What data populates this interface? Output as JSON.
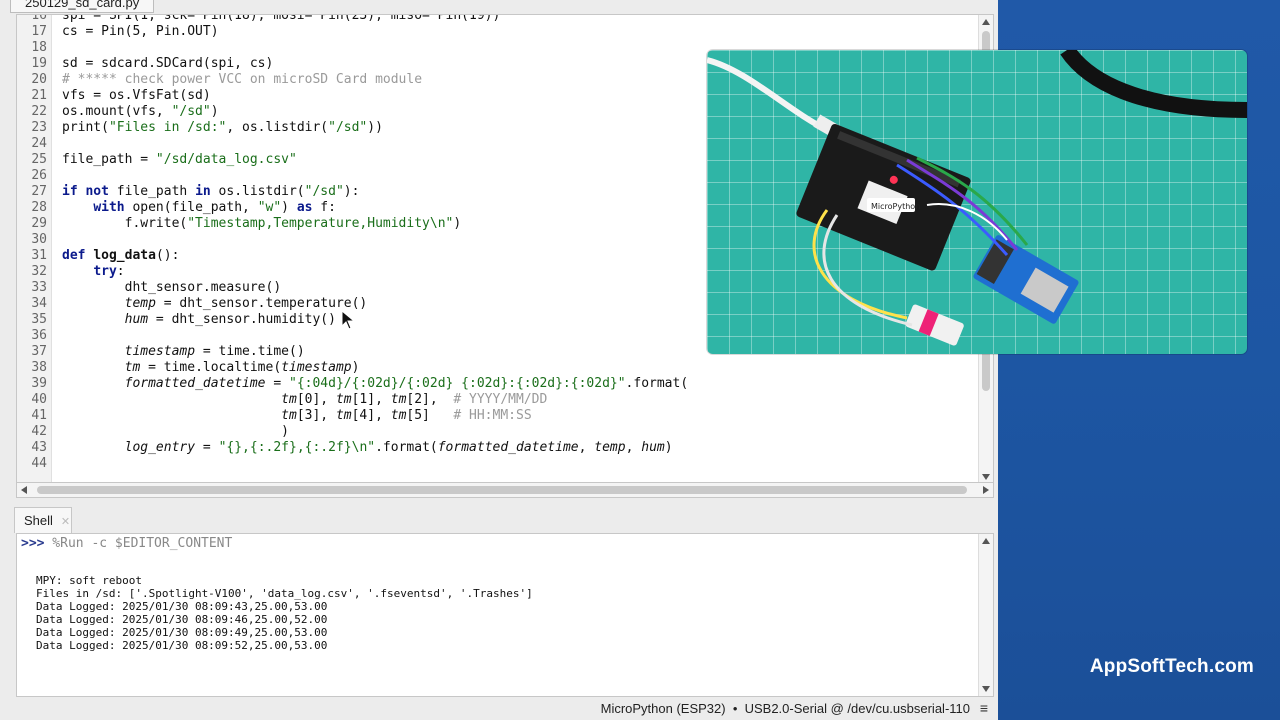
{
  "editor": {
    "tab_title": "250129_sd_card.py",
    "lines": [
      {
        "n": "16",
        "html": "spi = SPI(1, sck= Pin(18), mosi= Pin(23), miso= Pin(19))"
      },
      {
        "n": "17",
        "html": "cs = Pin(5, Pin.OUT)"
      },
      {
        "n": "18",
        "html": ""
      },
      {
        "n": "19",
        "html": "sd = sdcard.SDCard(spi, cs)"
      },
      {
        "n": "20",
        "html": "<span class='cm'># ***** check power VCC on microSD Card module</span>"
      },
      {
        "n": "21",
        "html": "vfs = os.VfsFat(sd)"
      },
      {
        "n": "22",
        "html": "os.mount(vfs, <span class='str'>\"/sd\"</span>)"
      },
      {
        "n": "23",
        "html": "print(<span class='str'>\"Files in /sd:\"</span>, os.listdir(<span class='str'>\"/sd\"</span>))"
      },
      {
        "n": "24",
        "html": ""
      },
      {
        "n": "25",
        "html": "file_path = <span class='str'>\"/sd/data_log.csv\"</span>"
      },
      {
        "n": "26",
        "html": ""
      },
      {
        "n": "27",
        "html": "<span class='kw'>if not</span> file_path <span class='kw'>in</span> os.listdir(<span class='str'>\"/sd\"</span>):"
      },
      {
        "n": "28",
        "html": "    <span class='kw'>with</span> open(file_path, <span class='str'>\"w\"</span>) <span class='kw'>as</span> f:"
      },
      {
        "n": "29",
        "html": "        f.write(<span class='str'>\"Timestamp,Temperature,Humidity\\n\"</span>)"
      },
      {
        "n": "30",
        "html": ""
      },
      {
        "n": "31",
        "html": "<span class='kw'>def</span> <b>log_data</b>():"
      },
      {
        "n": "32",
        "html": "    <span class='kw'>try</span>:"
      },
      {
        "n": "33",
        "html": "        dht_sensor.measure()"
      },
      {
        "n": "34",
        "html": "        <span class='it'>temp</span> = dht_sensor.temperature()"
      },
      {
        "n": "35",
        "html": "        <span class='it'>hum</span> = dht_sensor.humidity()"
      },
      {
        "n": "36",
        "html": ""
      },
      {
        "n": "37",
        "html": "        <span class='it'>timestamp</span> = time.time()"
      },
      {
        "n": "38",
        "html": "        <span class='it'>tm</span> = time.localtime(<span class='it'>timestamp</span>)"
      },
      {
        "n": "39",
        "html": "        <span class='it'>formatted_datetime</span> = <span class='str'>\"{:04d}/{:02d}/{:02d} {:02d}:{:02d}:{:02d}\"</span>.format("
      },
      {
        "n": "40",
        "html": "                            <span class='it'>tm</span>[0], <span class='it'>tm</span>[1], <span class='it'>tm</span>[2],  <span class='cm'># YYYY/MM/DD</span>"
      },
      {
        "n": "41",
        "html": "                            <span class='it'>tm</span>[3], <span class='it'>tm</span>[4], <span class='it'>tm</span>[5]   <span class='cm'># HH:MM:SS</span>"
      },
      {
        "n": "42",
        "html": "                            )"
      },
      {
        "n": "43",
        "html": "        <span class='it'>log_entry</span> = <span class='str'>\"{},{:.2f},{:.2f}\\n\"</span>.format(<span class='it'>formatted_datetime</span>, <span class='it'>temp</span>, <span class='it'>hum</span>)"
      },
      {
        "n": "44",
        "html": ""
      }
    ]
  },
  "shell": {
    "tab_label": "Shell",
    "prompt": ">>>",
    "command": " %Run -c $EDITOR_CONTENT",
    "output": [
      "MPY: soft reboot",
      "Files in /sd: ['.Spotlight-V100', 'data_log.csv', '.fseventsd', '.Trashes']",
      "Data Logged: 2025/01/30 08:09:43,25.00,53.00",
      "Data Logged: 2025/01/30 08:09:46,25.00,52.00",
      "Data Logged: 2025/01/30 08:09:49,25.00,53.00",
      "Data Logged: 2025/01/30 08:09:52,25.00,53.00"
    ]
  },
  "status": {
    "text": "MicroPython (ESP32)  •  USB2.0-Serial @ /dev/cu.usbserial-110",
    "menu_icon": "≡"
  },
  "branding": {
    "text": "AppSoftTech.com"
  },
  "photo": {
    "label": "MicroPython"
  },
  "colors": {
    "keyword": "#0b1a8c",
    "string": "#1a6e1a",
    "comment": "#9a9a9a",
    "background_blue": "#1f5aa8"
  }
}
